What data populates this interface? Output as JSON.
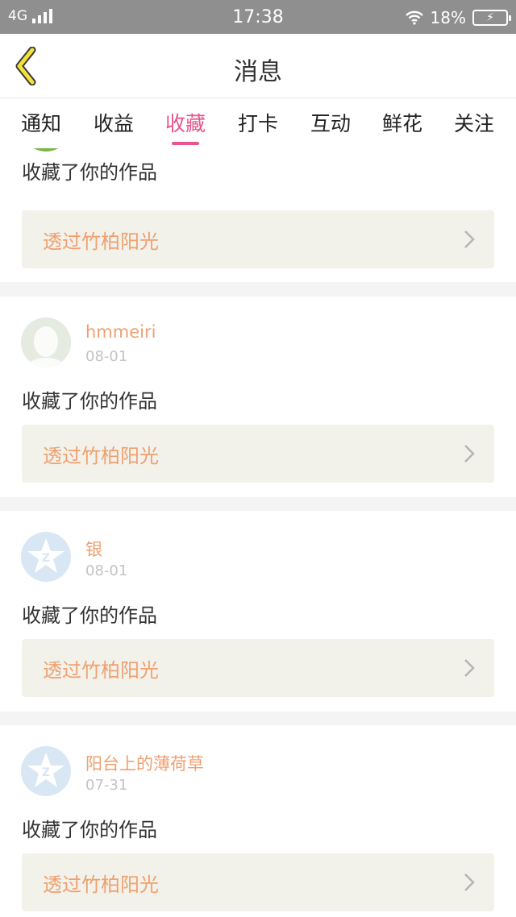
{
  "status_bar": {
    "network": "4G",
    "time": "17:38",
    "battery": "18%"
  },
  "header": {
    "title": "消息"
  },
  "tabs": [
    {
      "label": "通知"
    },
    {
      "label": "收益"
    },
    {
      "label": "收藏",
      "active": true
    },
    {
      "label": "打卡"
    },
    {
      "label": "互动"
    },
    {
      "label": "鲜花"
    },
    {
      "label": "关注"
    }
  ],
  "notifications": [
    {
      "action": "收藏了你的作品",
      "work": "透过竹柏阳光"
    },
    {
      "user": "hmmeiri",
      "date": "08-01",
      "action": "收藏了你的作品",
      "work": "透过竹柏阳光"
    },
    {
      "user": "银",
      "date": "08-01",
      "action": "收藏了你的作品",
      "work": "透过竹柏阳光"
    },
    {
      "user": "阳台上的薄荷草",
      "date": "07-31",
      "action": "收藏了你的作品",
      "work": "透过竹柏阳光"
    }
  ],
  "colors": {
    "accent": "#e8548b",
    "username": "#f0a070",
    "work_bg": "#f2f2ea",
    "status_bar": "#8f8f8f"
  }
}
